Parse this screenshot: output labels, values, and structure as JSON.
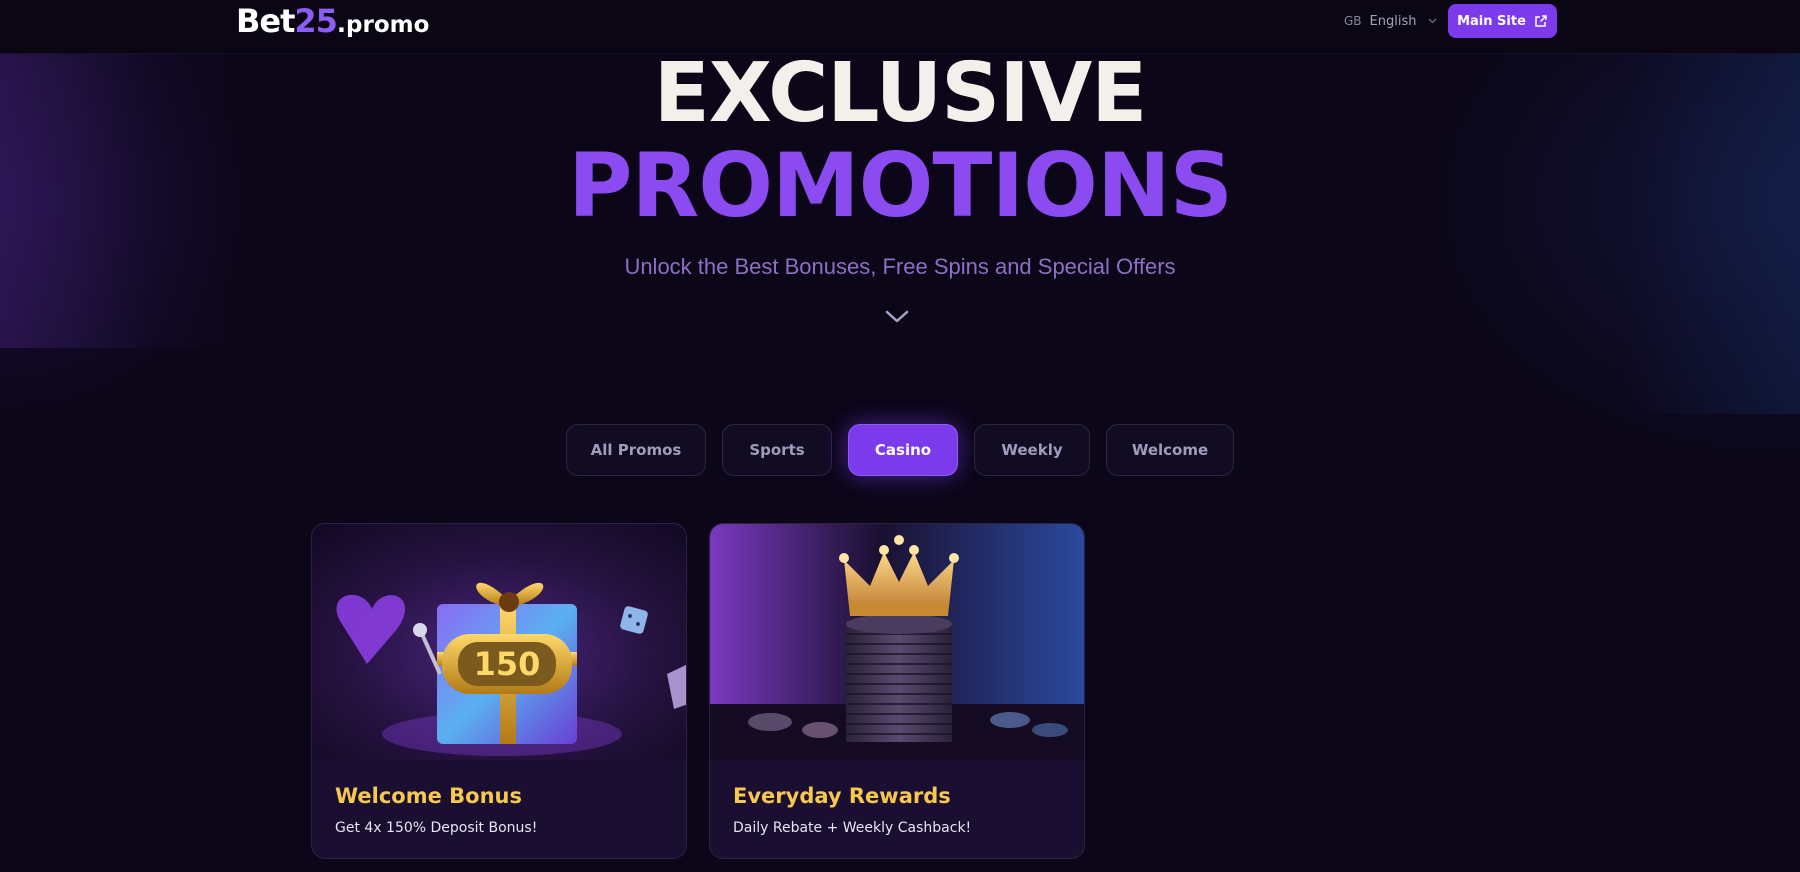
{
  "header": {
    "logo": {
      "main": "Bet",
      "number": "25",
      "dot": ".",
      "tld": "promo"
    },
    "language": {
      "code": "GB",
      "name": "English"
    },
    "main_site_label": "Main Site"
  },
  "hero": {
    "title_line1": "EXCLUSIVE",
    "title_line2": "PROMOTIONS",
    "subtitle": "Unlock the Best Bonuses, Free Spins and Special Offers"
  },
  "tabs": [
    {
      "label": "All Promos",
      "active": false
    },
    {
      "label": "Sports",
      "active": false
    },
    {
      "label": "Casino",
      "active": true
    },
    {
      "label": "Weekly",
      "active": false
    },
    {
      "label": "Welcome",
      "active": false
    }
  ],
  "cards": [
    {
      "title": "Welcome Bonus",
      "description": "Get 4x 150% Deposit Bonus!",
      "image": "gift-box-slot-150-image",
      "image_text": "150"
    },
    {
      "title": "Everyday Rewards",
      "description": "Daily Rebate + Weekly Cashback!",
      "image": "crown-coin-stack-image"
    }
  ],
  "colors": {
    "background": "#0b0618",
    "accent": "#7c3aed",
    "title_purple": "#8b4bf0",
    "card_title": "#f7c850"
  }
}
